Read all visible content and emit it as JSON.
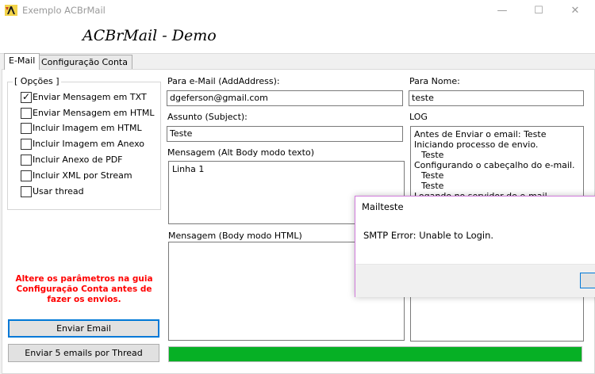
{
  "window": {
    "title": "Exemplo ACBrMail"
  },
  "header": {
    "title": "ACBrMail - Demo"
  },
  "tabs": [
    {
      "label": "E-Mail"
    },
    {
      "label": "Configuração Conta"
    }
  ],
  "options": {
    "legend": "[ Opções ]",
    "items": [
      {
        "label": "Enviar Mensagem em TXT",
        "checked": true
      },
      {
        "label": "Enviar Mensagem em HTML",
        "checked": false
      },
      {
        "label": "Incluir Imagem em HTML",
        "checked": false
      },
      {
        "label": "Incluir Imagem em Anexo",
        "checked": false
      },
      {
        "label": "Incluir Anexo de PDF",
        "checked": false
      },
      {
        "label": "Incluir XML por Stream",
        "checked": false
      },
      {
        "label": "Usar thread",
        "checked": false
      }
    ]
  },
  "warning": "Altere os parâmetros na guia Configuração Conta antes de fazer os envios.",
  "buttons": {
    "send": "Enviar Email",
    "send_thread": "Enviar 5 emails por Thread"
  },
  "form": {
    "to_label": "Para e-Mail (AddAddress):",
    "to_value": "dgeferson@gmail.com",
    "name_label": "Para Nome:",
    "name_value": "teste",
    "subject_label": "Assunto (Subject):",
    "subject_value": "Teste",
    "alt_body_label": "Mensagem (Alt Body modo texto)",
    "alt_body_value": "Linha 1",
    "html_body_label": "Mensagem (Body modo HTML)",
    "log_label": "LOG"
  },
  "log": [
    "Antes de Enviar o email: Teste",
    "Iniciando processo de envio.",
    "   Teste",
    "Configurando o cabeçalho do e-mail.",
    "   Teste",
    "   Teste",
    "Logando no servidor de e-mail"
  ],
  "progress": {
    "percent": 100,
    "color": "#06b025"
  },
  "dialog": {
    "title": "Mailteste",
    "message": "SMTP Error: Unable to Login."
  },
  "colors": {
    "warning": "#ff0000",
    "accent": "#0078d7",
    "dialog_border": "#d27bdc"
  },
  "icons": {
    "app": "acbr-app-icon",
    "minimize": "minimize-icon",
    "maximize": "maximize-icon",
    "close": "close-icon",
    "check": "checkmark-icon"
  }
}
